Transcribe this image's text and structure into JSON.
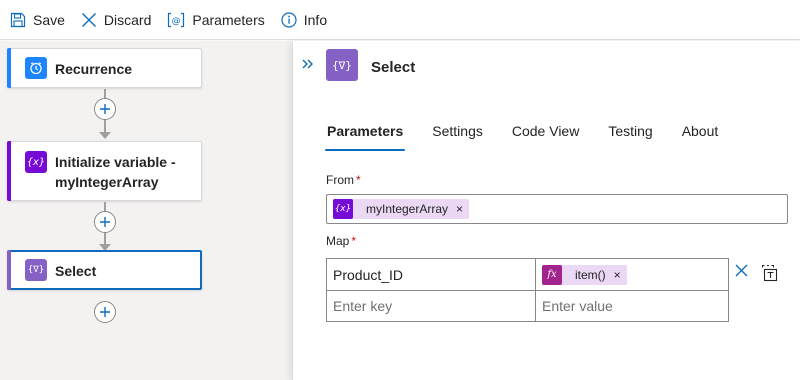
{
  "toolbar": {
    "save_label": "Save",
    "discard_label": "Discard",
    "parameters_label": "Parameters",
    "info_label": "Info"
  },
  "canvas": {
    "nodes": [
      {
        "label": "Recurrence",
        "color": "#1f85ff",
        "icon": "clock-icon"
      },
      {
        "label_line1": "Initialize variable -",
        "label_line2": "myIntegerArray",
        "color": "#770bd6",
        "icon": "variable-icon"
      },
      {
        "label": "Select",
        "color": "#8661c5",
        "icon": "select-icon",
        "selected": true
      }
    ]
  },
  "panel": {
    "title": "Select",
    "tabs": [
      {
        "label": "Parameters",
        "active": true
      },
      {
        "label": "Settings"
      },
      {
        "label": "Code View"
      },
      {
        "label": "Testing"
      },
      {
        "label": "About"
      }
    ],
    "from": {
      "label": "From",
      "required_mark": "*",
      "token": {
        "text": "myIntegerArray",
        "remove": "×",
        "icon": "variable-icon"
      }
    },
    "map": {
      "label": "Map",
      "required_mark": "*",
      "rows": [
        {
          "key": "Product_ID",
          "value_token": {
            "text": "item()",
            "remove": "×",
            "icon": "fx-icon"
          }
        },
        {
          "key_placeholder": "Enter key",
          "value_placeholder": "Enter value"
        }
      ]
    }
  },
  "colors": {
    "accent": "#0f6cbd",
    "token_bg": "#ead8f5",
    "variable": "#770bd6",
    "select": "#8661c5",
    "recurrence": "#1f85ff",
    "fx": "#a1248e"
  }
}
